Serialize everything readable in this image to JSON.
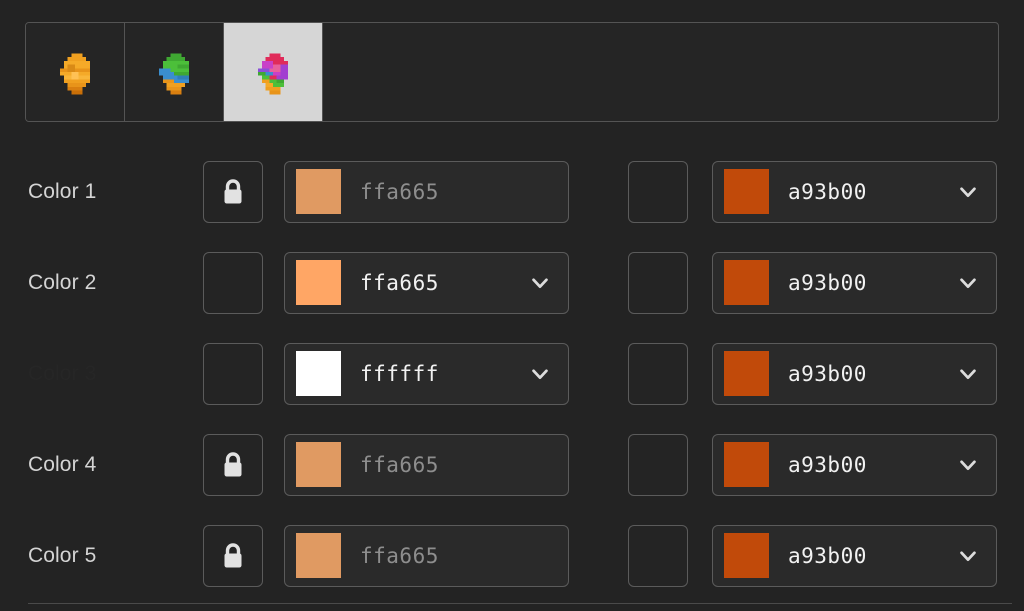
{
  "window": {
    "background": "#232323"
  },
  "tabs": {
    "items": [
      {
        "name": "tab-sprite-orange",
        "icon": "sprite-thumbnail-icon",
        "selected": false,
        "palette_label": "orange"
      },
      {
        "name": "tab-sprite-green",
        "icon": "sprite-thumbnail-icon",
        "selected": false,
        "palette_label": "green-blue"
      },
      {
        "name": "tab-sprite-rainbow",
        "icon": "sprite-thumbnail-icon",
        "selected": true,
        "palette_label": "rainbow"
      }
    ],
    "selected_index": 2,
    "selected_background": "#d6d6d6"
  },
  "rows": [
    {
      "label": "Color 1",
      "label_visible": true,
      "left": {
        "locked": true,
        "lock_icon": "lock-closed-icon",
        "hex": "ffa665",
        "swatch": "#e09a62",
        "enabled": false,
        "has_dropdown": false
      },
      "right": {
        "locked": false,
        "lock_icon": "",
        "hex": "a93b00",
        "swatch": "#c14a0a",
        "enabled": true,
        "has_dropdown": true
      }
    },
    {
      "label": "Color 2",
      "label_visible": true,
      "left": {
        "locked": false,
        "lock_icon": "",
        "hex": "ffa665",
        "swatch": "#ffa665",
        "enabled": true,
        "has_dropdown": true
      },
      "right": {
        "locked": false,
        "lock_icon": "",
        "hex": "a93b00",
        "swatch": "#c14a0a",
        "enabled": true,
        "has_dropdown": true
      }
    },
    {
      "label": "Color 3",
      "label_visible": false,
      "left": {
        "locked": false,
        "lock_icon": "",
        "hex": "ffffff",
        "swatch": "#ffffff",
        "enabled": true,
        "has_dropdown": true
      },
      "right": {
        "locked": false,
        "lock_icon": "",
        "hex": "a93b00",
        "swatch": "#c14a0a",
        "enabled": true,
        "has_dropdown": true
      }
    },
    {
      "label": "Color 4",
      "label_visible": true,
      "left": {
        "locked": true,
        "lock_icon": "lock-closed-icon",
        "hex": "ffa665",
        "swatch": "#e09a62",
        "enabled": false,
        "has_dropdown": false
      },
      "right": {
        "locked": false,
        "lock_icon": "",
        "hex": "a93b00",
        "swatch": "#c14a0a",
        "enabled": true,
        "has_dropdown": true
      }
    },
    {
      "label": "Color 5",
      "label_visible": true,
      "left": {
        "locked": true,
        "lock_icon": "lock-closed-icon",
        "hex": "ffa665",
        "swatch": "#e09a62",
        "enabled": false,
        "has_dropdown": false
      },
      "right": {
        "locked": false,
        "lock_icon": "",
        "hex": "a93b00",
        "swatch": "#c14a0a",
        "enabled": true,
        "has_dropdown": true
      }
    }
  ]
}
